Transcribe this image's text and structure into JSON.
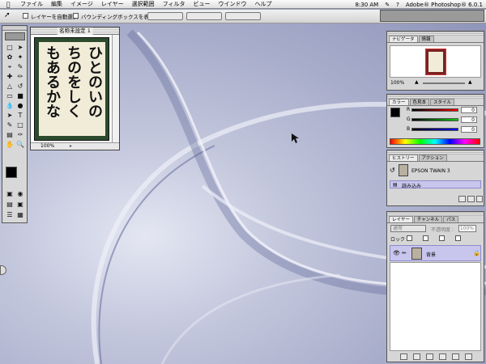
{
  "menubar": {
    "items": [
      "ファイル",
      "編集",
      "イメージ",
      "レイヤー",
      "選択範囲",
      "フィルタ",
      "ビュー",
      "ウインドウ",
      "ヘルプ"
    ],
    "clock": "8:30 AM",
    "app_name": "Adobe® Photoshop® 6.0.1"
  },
  "options": {
    "auto_select_label": "レイヤーを自動選択",
    "bounding_box_label": "バウンディングボックスを表示"
  },
  "document": {
    "title": "名称未設定 1",
    "zoom": "100%",
    "poem_columns": [
      "ひとのいの",
      "ちのをしく",
      "もあるかな"
    ]
  },
  "navigator": {
    "tabs": [
      "ナビゲータ",
      "情報"
    ],
    "zoom": "100%"
  },
  "color": {
    "tabs": [
      "カラー",
      "色見本",
      "スタイル"
    ],
    "channels": [
      {
        "label": "R",
        "value": "0",
        "color": "#cc2222"
      },
      {
        "label": "G",
        "value": "0",
        "color": "#22aa22"
      },
      {
        "label": "B",
        "value": "0",
        "color": "#2233cc"
      }
    ]
  },
  "history": {
    "tabs": [
      "ヒストリー",
      "アクション"
    ],
    "snapshot": "EPSON TWAIN 3",
    "states": [
      "読み込み"
    ]
  },
  "layers": {
    "tabs": [
      "レイヤー",
      "チャンネル",
      "パス"
    ],
    "blend_mode": "通常",
    "opacity_label": "不透明度 :",
    "opacity": "100%",
    "lock_label": "ロック :",
    "layer_name": "背景"
  }
}
